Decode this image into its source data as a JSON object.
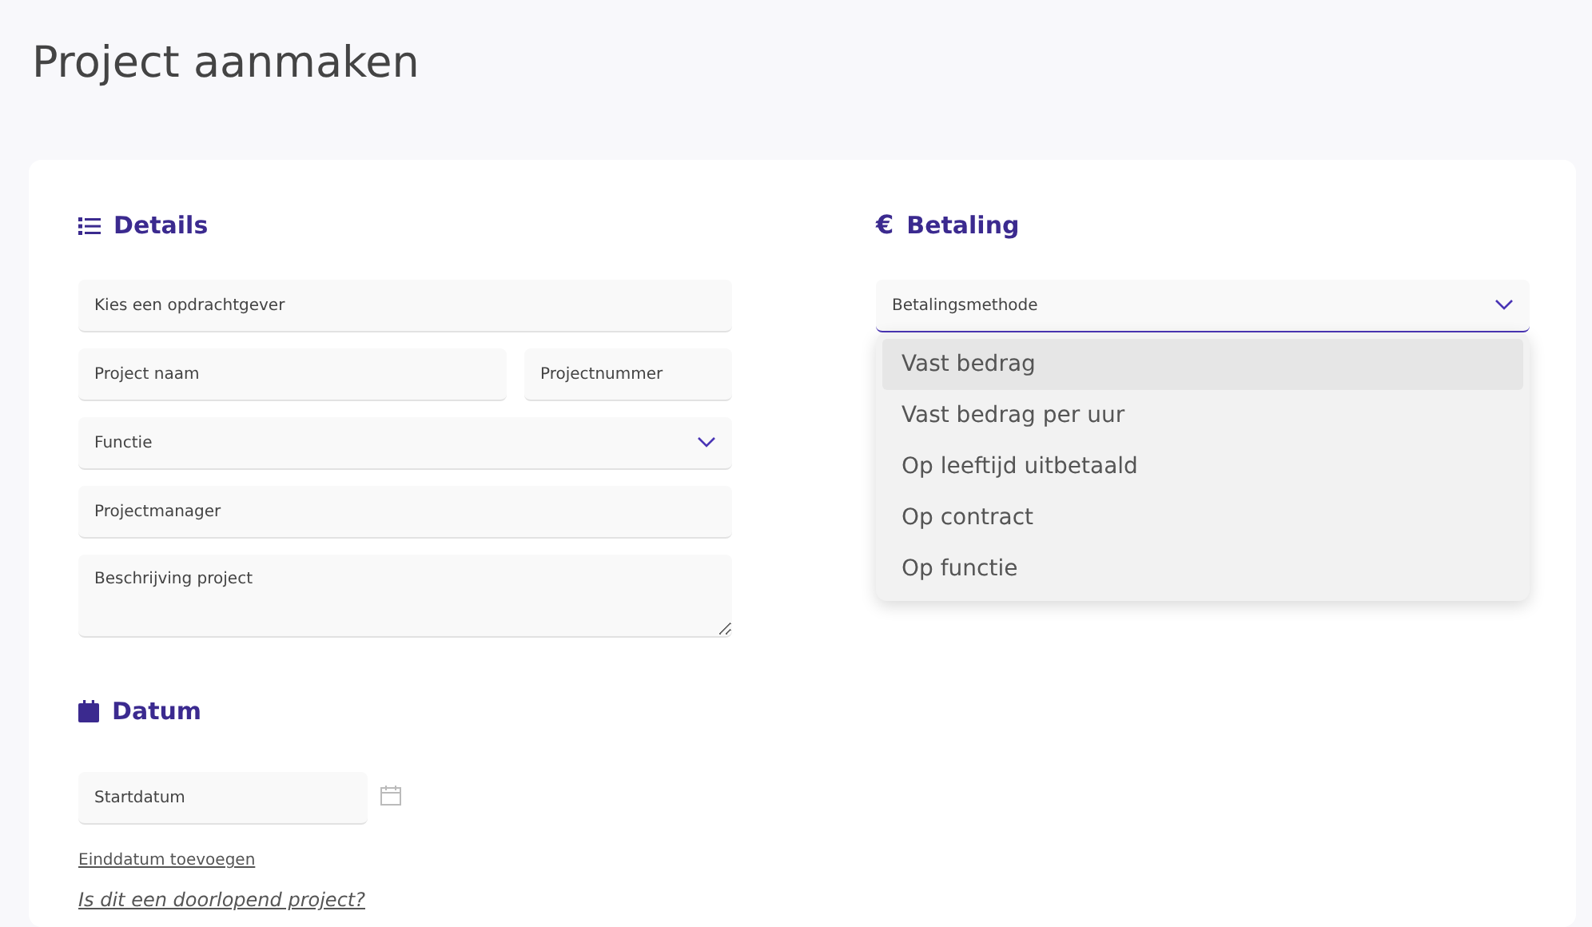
{
  "page_title": "Project aanmaken",
  "details": {
    "heading": "Details",
    "rows": [
      [
        {
          "kind": "picker",
          "placeholder": "Kies een opdrachtgever"
        }
      ],
      [
        {
          "kind": "text",
          "placeholder": "Project naam"
        },
        {
          "kind": "text",
          "placeholder": "Projectnummer"
        }
      ],
      [
        {
          "kind": "select",
          "placeholder": "Functie"
        }
      ],
      [
        {
          "kind": "text",
          "placeholder": "Projectmanager"
        }
      ],
      [
        {
          "kind": "textarea",
          "placeholder": "Beschrijving project"
        }
      ]
    ]
  },
  "datum": {
    "heading": "Datum",
    "start_field": {
      "placeholder": "Startdatum"
    },
    "links": [
      {
        "kind": "plain",
        "text": "Einddatum toevoegen"
      },
      {
        "kind": "italic",
        "text": "Is dit een doorlopend project?"
      }
    ]
  },
  "betaling": {
    "icon": "€",
    "heading": "Betaling",
    "select": {
      "placeholder": "Betalingsmethode",
      "expanded": true
    },
    "options": [
      {
        "label": "Vast bedrag",
        "selected": true
      },
      {
        "label": "Vast bedrag per uur",
        "selected": false
      },
      {
        "label": "Op leeftijd uitbetaald",
        "selected": false
      },
      {
        "label": "Op contract",
        "selected": false
      },
      {
        "label": "Op functie",
        "selected": false
      }
    ]
  }
}
